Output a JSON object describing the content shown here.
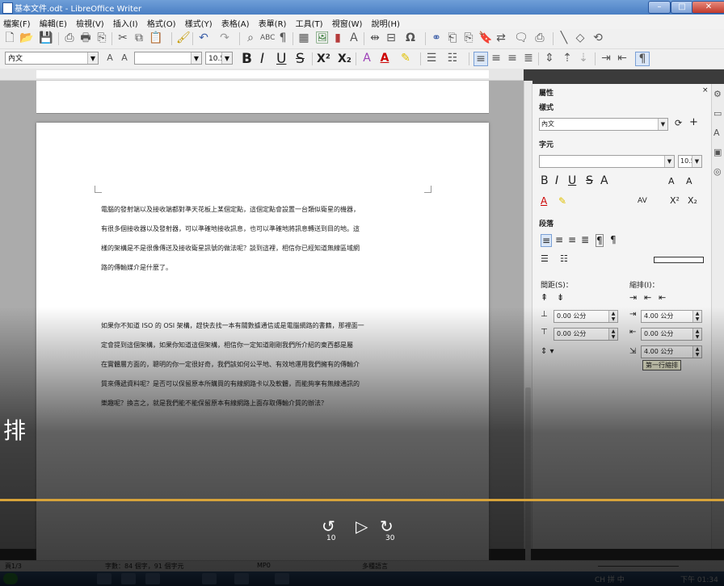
{
  "window": {
    "title": "基本文件.odt - LibreOffice Writer"
  },
  "menu": [
    "檔案(F)",
    "編輯(E)",
    "檢視(V)",
    "插入(I)",
    "格式(O)",
    "樣式(Y)",
    "表格(A)",
    "表單(R)",
    "工具(T)",
    "視窗(W)",
    "說明(H)"
  ],
  "formatting": {
    "para_style": "內文",
    "font_name": "",
    "font_size": "10.5",
    "bold": "B",
    "italic": "I",
    "underline": "U",
    "strike": "S",
    "superscript": "X²",
    "subscript": "X₂"
  },
  "document": {
    "paragraphs": [
      "電腦的發射端以及接收端都對準天花板上某個定點，這個定點會設置一台類似衛星的機器，有很多個接收器以及發射器，可以準確地接收訊息，也可以準確地將訊息轉送到目的地，這樣的架構是不是很像傳送及接收衛星訊號的做法呢？談到這裡，相信你已經知道無線區域網路的傳輸媒介是什麼了。",
      "如果你不知道ISO的OSI架構，趕快去找一本有關數據通信或是電腦網路的書籍，那裡面一定會提到這個架構，如果你知道這個架構，相信你一定知道剛剛我們所介紹的東西都是屬 於實體層方面的，聰明的你一定很好奇，我們該如何公平地、有效地運用我們擁有的傳輸介質來傳遞資料呢？是否可以保留原本所購買的有線網路卡以及軟體，而能夠享有無線通訊的樂趣呢？換言之，就是我們能不能保留原本有線網路上面存取傳輸介質的辦法？"
    ],
    "lines": [
      "電腦的發射端以及接收端都對準天花板上某個定點，這個定點會設置一台類似衛星的機器，",
      "有很多個接收器以及發射器，可以準確地接收訊息，也可以準確地將訊息轉送到目的地。這",
      "樣的架構是不是很像傳送及接收衛星訊號的做法呢？談到這裡，相信你已經知道無線區域網",
      "路的傳輸媒介是什麼了。",
      "",
      "如果你不知道 ISO 的 OSI 架構，趕快去找一本有關數據通信或是電腦網路的書籍，那裡面一",
      "定會提到這個架構，如果你知道這個架構，相信你一定知道剛剛我們所介紹的東西都是屬",
      "在實體層方面的，聰明的你一定很好奇，我們該如何公平地、有效地運用我們擁有的傳輸介",
      "質來傳遞資料呢？是否可以保留原本所購買的有線網路卡以及軟體，而能夠享有無線通訊的",
      "樂趣呢？換言之，就是我們能不能保留原本有線網路上面存取傳輸介質的辦法？"
    ]
  },
  "sidebar": {
    "title": "屬性",
    "styles_header": "樣式",
    "style_value": "內文",
    "char_header": "字元",
    "font_value": "",
    "size_value": "10.5",
    "char_buttons": [
      "B",
      "I",
      "U",
      "S",
      "A"
    ],
    "para_header": "段落",
    "spacing_label": "間距(S)：",
    "indent_label": "縮排(I)：",
    "above": "0.00 公分",
    "below": "0.00 公分",
    "before_text": "4.00 公分",
    "after_text": "0.00 公分",
    "first_line": "4.00 公分",
    "tooltip": "第一行縮排"
  },
  "status": {
    "page": "頁1/3",
    "words": "字數：84 個字，91 個字元",
    "mode": "MP0",
    "lang": "多種語言"
  },
  "overlay": {
    "big_char": "排",
    "rewind_label": "10",
    "forward_label": "30",
    "progress": 1.0
  },
  "clock": "下午 01:34",
  "ime": "CH 拼 中"
}
